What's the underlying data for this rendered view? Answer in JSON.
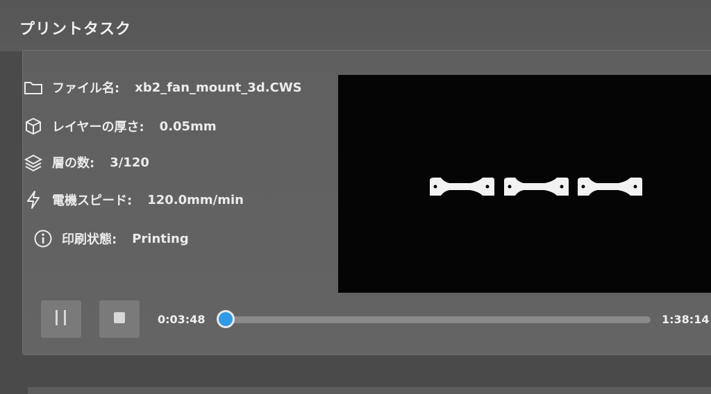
{
  "header": {
    "title": "プリントタスク"
  },
  "info": {
    "file_name": {
      "label": "ファイル名:",
      "value": "xb2_fan_mount_3d.CWS",
      "icon": "folder-icon"
    },
    "layer_thickness": {
      "label": "レイヤーの厚さ:",
      "value": "0.05mm",
      "icon": "cube-icon"
    },
    "layer_count": {
      "label": "層の数:",
      "value": "3/120",
      "icon": "layers-icon"
    },
    "motor_speed": {
      "label": "電機スピード:",
      "value": "120.0mm/min",
      "icon": "lightning-icon"
    },
    "print_status": {
      "label": "印刷状態:",
      "value": "Printing",
      "icon": "info-icon"
    }
  },
  "controls": {
    "pause_icon": "pause-icon",
    "stop_icon": "stop-icon"
  },
  "progress": {
    "elapsed": "0:03:48",
    "remaining": "1:38:14",
    "fraction": 0.0
  },
  "colors": {
    "accent": "#2f9ae8",
    "panel": "#636363",
    "preview_bg": "#050505"
  }
}
